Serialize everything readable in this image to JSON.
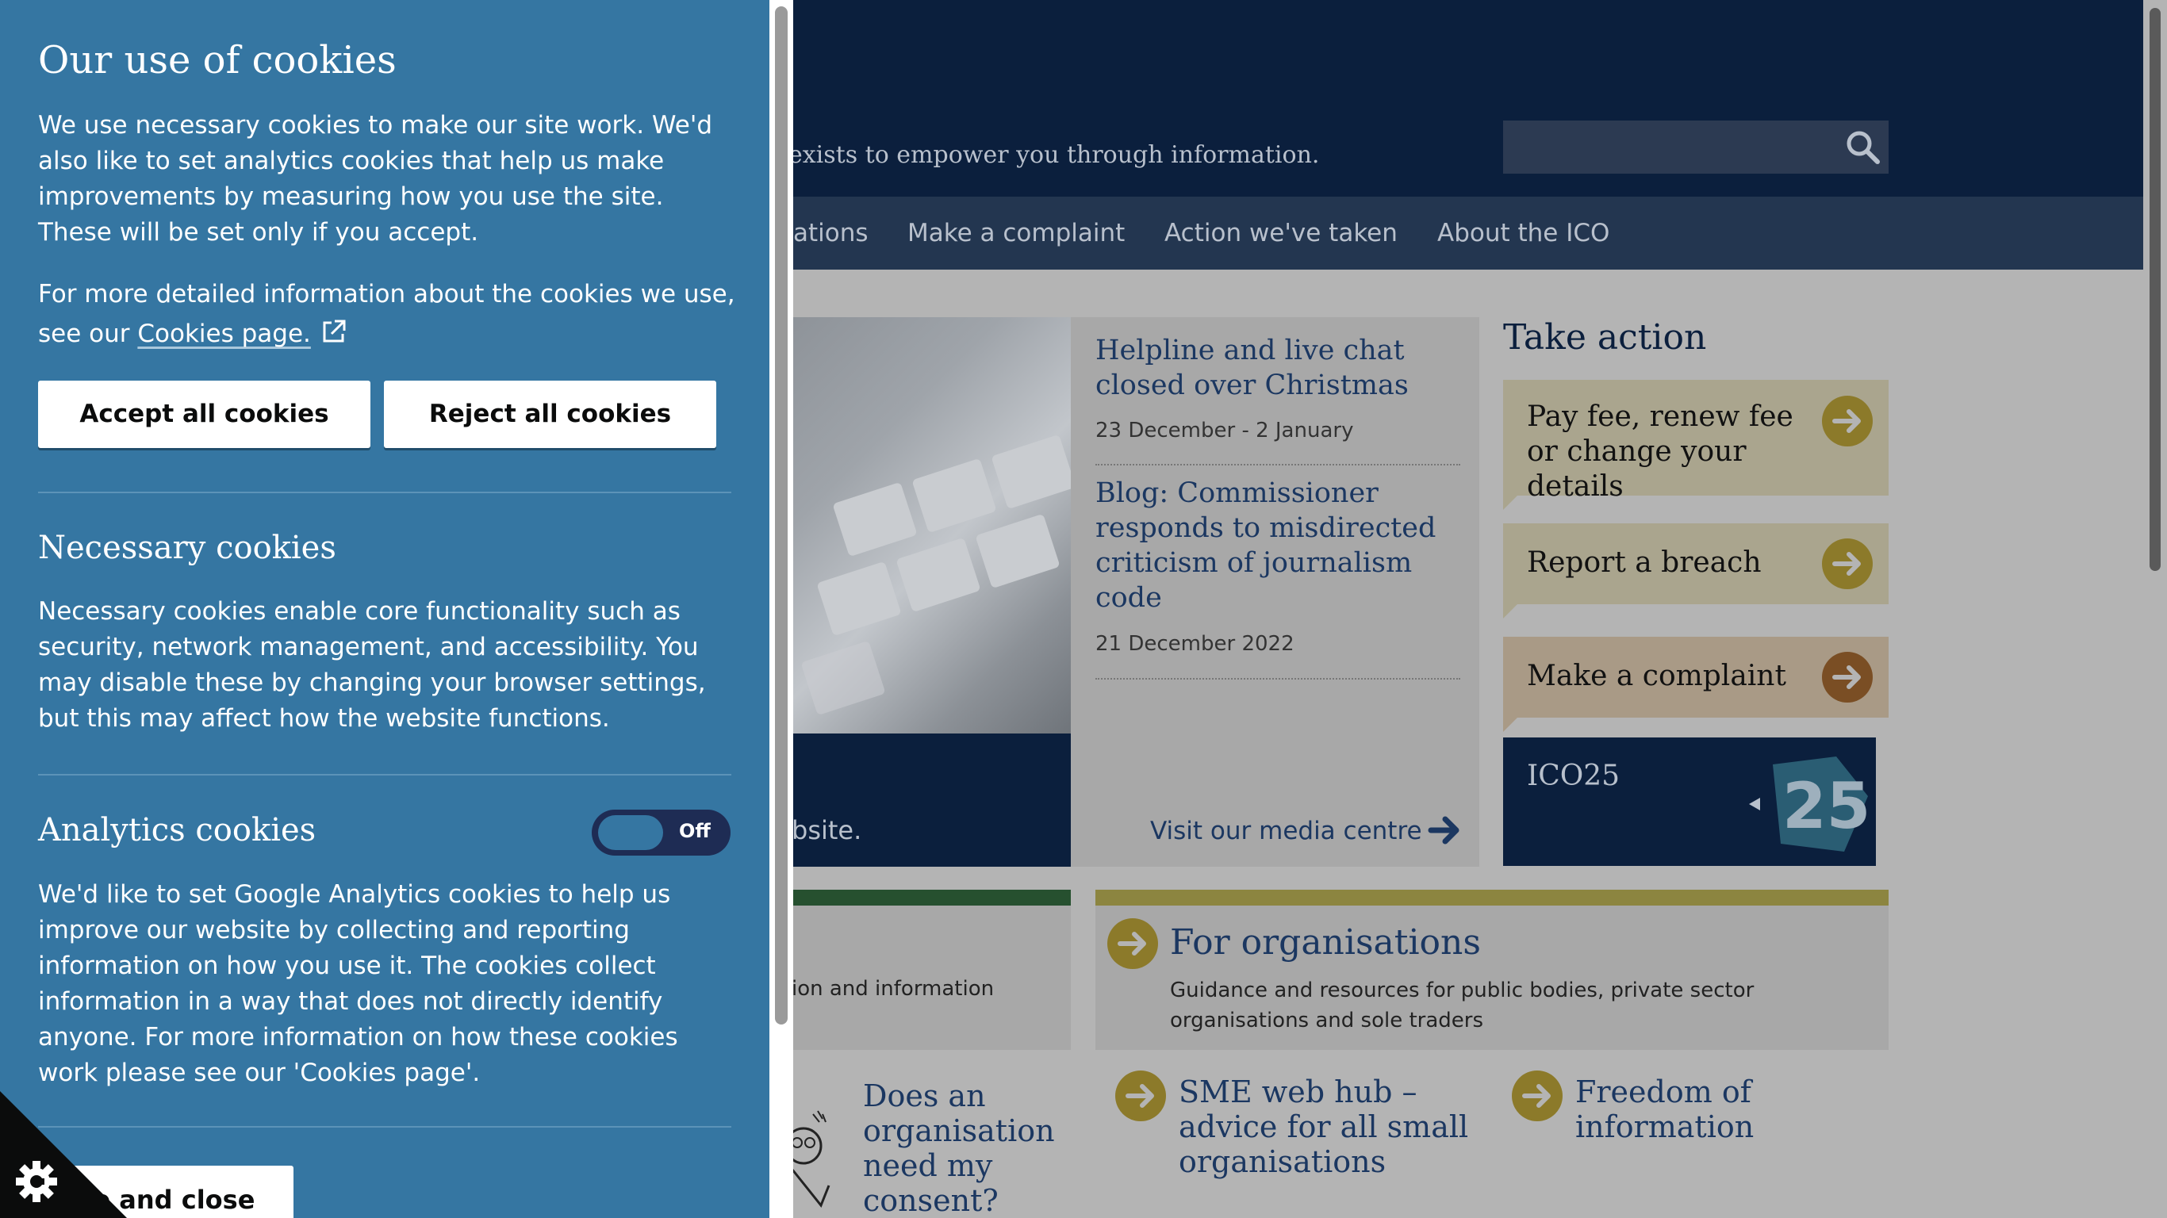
{
  "site": {
    "strapline": "exists to empower you through information.",
    "search": {
      "placeholder": ""
    },
    "nav": [
      "ations",
      "Make a complaint",
      "Action we've taken",
      "About the ICO"
    ],
    "hero_caption": "bsite.",
    "news": [
      {
        "title": "Helpline and live chat closed over Christmas",
        "date": "23 December - 2 January"
      },
      {
        "title": "Blog: Commissioner responds to misdirected criticism of journalism code",
        "date": "21 December 2022"
      }
    ],
    "media_link": "Visit our media centre",
    "take_action": {
      "title": "Take action",
      "items": [
        "Pay fee, renew fee or change your details",
        "Report a breach",
        "Make a complaint"
      ]
    },
    "ico25": "ICO25",
    "public_desc": "ion and information",
    "organisations": {
      "title": "For organisations",
      "desc": "Guidance and resources for public bodies, private sector organisations and sole traders"
    },
    "links": [
      "Does an organisation need my consent?",
      "SME web hub – advice for all small organisations",
      "Freedom of information"
    ]
  },
  "cookie_panel": {
    "title": "Our use of cookies",
    "intro": "We use necessary cookies to make our site work. We'd also like to set analytics cookies that help us make improvements by measuring how you use the site. These will be set only if you accept.",
    "more_info_prefix": "For more detailed information about the cookies we use, see our ",
    "cookies_page_link": "Cookies page.",
    "accept_label": "Accept all cookies",
    "reject_label": "Reject all cookies",
    "necessary": {
      "title": "Necessary cookies",
      "text": "Necessary cookies enable core functionality such as security, network management, and accessibility. You may disable these by changing your browser settings, but this may affect how the website functions."
    },
    "analytics": {
      "title": "Analytics cookies",
      "toggle_state": "Off",
      "text": "We'd like to set Google Analytics cookies to help us improve our website by collecting and reporting information on how you use it. The cookies collect information in a way that does not directly identify anyone. For more information on how these cookies work please see our 'Cookies page'."
    },
    "save_label": "ve and close"
  },
  "colors": {
    "panel": "#3576a2",
    "header": "#0b1f3d",
    "overlay": "#b4b4b4",
    "accent": "#8c7a2a"
  },
  "icons": [
    "search-icon",
    "arrow-right-icon",
    "external-link-icon",
    "cookie-settings-icon"
  ]
}
